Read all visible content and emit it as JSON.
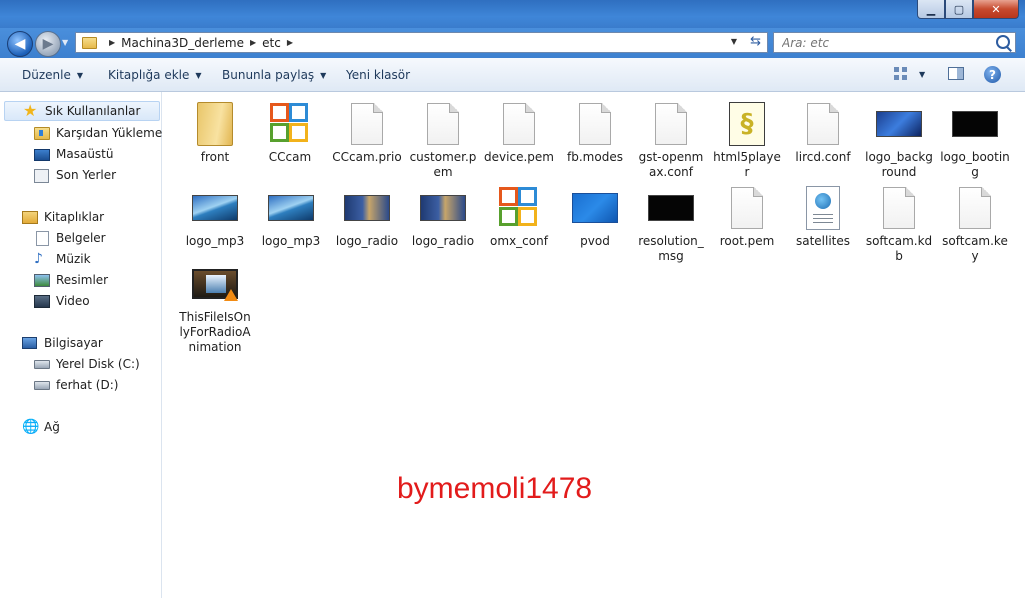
{
  "window": {
    "min_glyph": "▁",
    "max_glyph": "▢",
    "close_glyph": "✕"
  },
  "address": {
    "back_glyph": "◀",
    "forward_glyph": "▶",
    "crumbs": [
      "Machina3D_derleme",
      "etc"
    ],
    "search_placeholder": "Ara: etc"
  },
  "toolbar": {
    "organize": "Düzenle",
    "include_library": "Kitaplığa ekle",
    "share_with": "Bununla paylaş",
    "new_folder": "Yeni klasör",
    "help_glyph": "?"
  },
  "nav": {
    "favorites": "Sık Kullanılanlar",
    "downloads": "Karşıdan Yüklemeler",
    "desktop": "Masaüstü",
    "recent": "Son Yerler",
    "libraries": "Kitaplıklar",
    "documents": "Belgeler",
    "music": "Müzik",
    "pictures": "Resimler",
    "video": "Video",
    "computer": "Bilgisayar",
    "drive_c": "Yerel Disk (C:)",
    "drive_d": "ferhat (D:)",
    "network": "Ağ"
  },
  "files": [
    {
      "name": "front",
      "type": "folder"
    },
    {
      "name": "CCcam",
      "type": "office"
    },
    {
      "name": "CCcam.prio",
      "type": "blank"
    },
    {
      "name": "customer.pem",
      "type": "blank"
    },
    {
      "name": "device.pem",
      "type": "blank"
    },
    {
      "name": "fb.modes",
      "type": "blank"
    },
    {
      "name": "gst-openmax.conf",
      "type": "blank"
    },
    {
      "name": "html5player",
      "type": "script"
    },
    {
      "name": "lircd.conf",
      "type": "blank"
    },
    {
      "name": "logo_background",
      "type": "image-blue"
    },
    {
      "name": "logo_booting",
      "type": "image-black"
    },
    {
      "name": "logo_mp3",
      "type": "image-mp3"
    },
    {
      "name": "logo_mp3",
      "type": "image-mp3"
    },
    {
      "name": "logo_radio",
      "type": "image-radio"
    },
    {
      "name": "logo_radio",
      "type": "image-radio"
    },
    {
      "name": "omx_conf",
      "type": "office"
    },
    {
      "name": "pvod",
      "type": "image-pvod"
    },
    {
      "name": "resolution_msg",
      "type": "image-black"
    },
    {
      "name": "root.pem",
      "type": "blank"
    },
    {
      "name": "satellites",
      "type": "web"
    },
    {
      "name": "softcam.kdb",
      "type": "blank"
    },
    {
      "name": "softcam.key",
      "type": "blank"
    },
    {
      "name": "ThisFileIsOnlyForRadioAnimation",
      "type": "video"
    }
  ],
  "watermark": "bymemoli1478",
  "colors": {
    "watermark": "#e21b1b",
    "titlebar": "#3f86d8"
  }
}
